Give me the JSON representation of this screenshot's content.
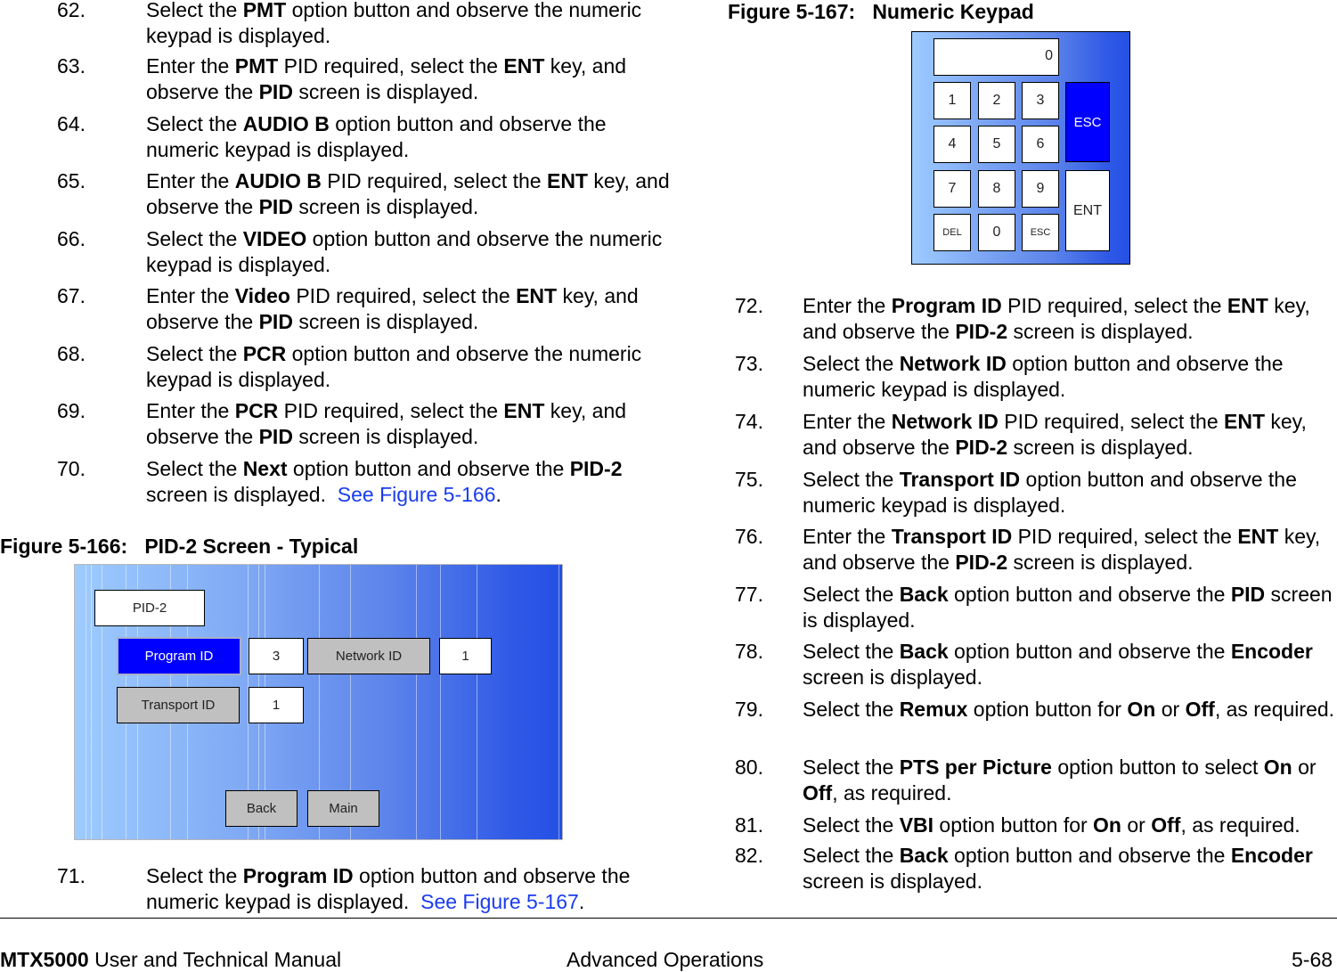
{
  "left_steps": [
    {
      "num": "62.",
      "html": "Select the <b>PMT</b> option button and observe the numeric keypad is displayed."
    },
    {
      "num": "63.",
      "html": "Enter the <b>PMT</b> PID required, select the <b>ENT</b> key, and observe the <b>PID</b> screen is displayed."
    },
    {
      "num": "64.",
      "html": "Select the <b>AUDIO B</b> option button and observe the numeric keypad is displayed."
    },
    {
      "num": "65.",
      "html": "Enter the <b>AUDIO B</b> PID required, select the <b>ENT</b> key, and observe the <b>PID</b> screen is displayed."
    },
    {
      "num": "66.",
      "html": "Select the <b>VIDEO</b> option button and observe the numeric keypad is displayed."
    },
    {
      "num": "67.",
      "html": "Enter the <b>Video</b> PID required, select the <b>ENT</b> key, and observe the <b>PID</b> screen is displayed."
    },
    {
      "num": "68.",
      "html": "Select the <b>PCR</b> option button and observe the numeric keypad is displayed."
    },
    {
      "num": "69.",
      "html": "Enter the <b>PCR</b> PID required, select the <b>ENT</b> key, and observe the <b>PID</b> screen is displayed."
    },
    {
      "num": "70.",
      "html": "Select the <b>Next</b> option button and observe the <b>PID-2</b> screen is displayed.&nbsp; <span class=\"link\">See Figure 5-166</span>."
    }
  ],
  "figure_166": {
    "title": "Figure 5-166:   PID-2 Screen - Typical",
    "screen_title": "PID-2",
    "program_id_label": "Program ID",
    "program_id_value": "3",
    "network_id_label": "Network ID",
    "network_id_value": "1",
    "transport_id_label": "Transport ID",
    "transport_id_value": "1",
    "back_label": "Back",
    "main_label": "Main"
  },
  "step_71": {
    "num": "71.",
    "html": "Select the <b>Program ID</b> option button and observe the numeric keypad is displayed.&nbsp; <span class=\"link\">See Figure 5-167</span>."
  },
  "figure_167": {
    "title": "Figure 5-167:   Numeric Keypad",
    "display_value": "0",
    "keys": [
      "1",
      "2",
      "3",
      "4",
      "5",
      "6",
      "7",
      "8",
      "9",
      "DEL",
      "0",
      "ESC"
    ],
    "esc_label": "ESC",
    "ent_label": "ENT"
  },
  "right_steps": [
    {
      "num": "72.",
      "html": "Enter the <b>Program ID</b> PID required, select the <b>ENT</b> key, and observe the <b>PID-2</b> screen is displayed."
    },
    {
      "num": "73.",
      "html": "Select the <b>Network ID</b> option button and observe the numeric keypad is displayed."
    },
    {
      "num": "74.",
      "html": "Enter the <b>Network ID</b> PID required, select the <b>ENT</b> key, and observe the <b>PID-2</b> screen is displayed."
    },
    {
      "num": "75.",
      "html": "Select the <b>Transport ID</b> option button and observe the numeric keypad is displayed."
    },
    {
      "num": "76.",
      "html": "Enter the <b>Transport ID</b> PID required, select the <b>ENT</b> key, and observe the <b>PID-2</b> screen is displayed."
    },
    {
      "num": "77.",
      "html": "Select the <b>Back</b> option button and observe the <b>PID</b> screen is displayed."
    },
    {
      "num": "78.",
      "html": "Select the <b>Back</b> option button and observe the <b>Encoder</b> screen is displayed."
    },
    {
      "num": "79.",
      "html": "Select the <b>Remux</b> option button for <b>On</b> or <b>Off</b>, as required."
    },
    {
      "num": "80.",
      "html": "Select the <b>PTS per Picture</b> option button to select <b>On</b> or <b>Off</b>, as required."
    },
    {
      "num": "81.",
      "html": "Select the <b>VBI</b> option button for <b>On</b> or <b>Off</b>, as required."
    },
    {
      "num": "82.",
      "html": "Select the <b>Back</b> option button and observe the <b>Encoder</b> screen is displayed."
    }
  ],
  "footer": {
    "product": "MTX5000",
    "manual": " User and Technical Manual",
    "section": "Advanced Operations",
    "page": "5-68"
  }
}
